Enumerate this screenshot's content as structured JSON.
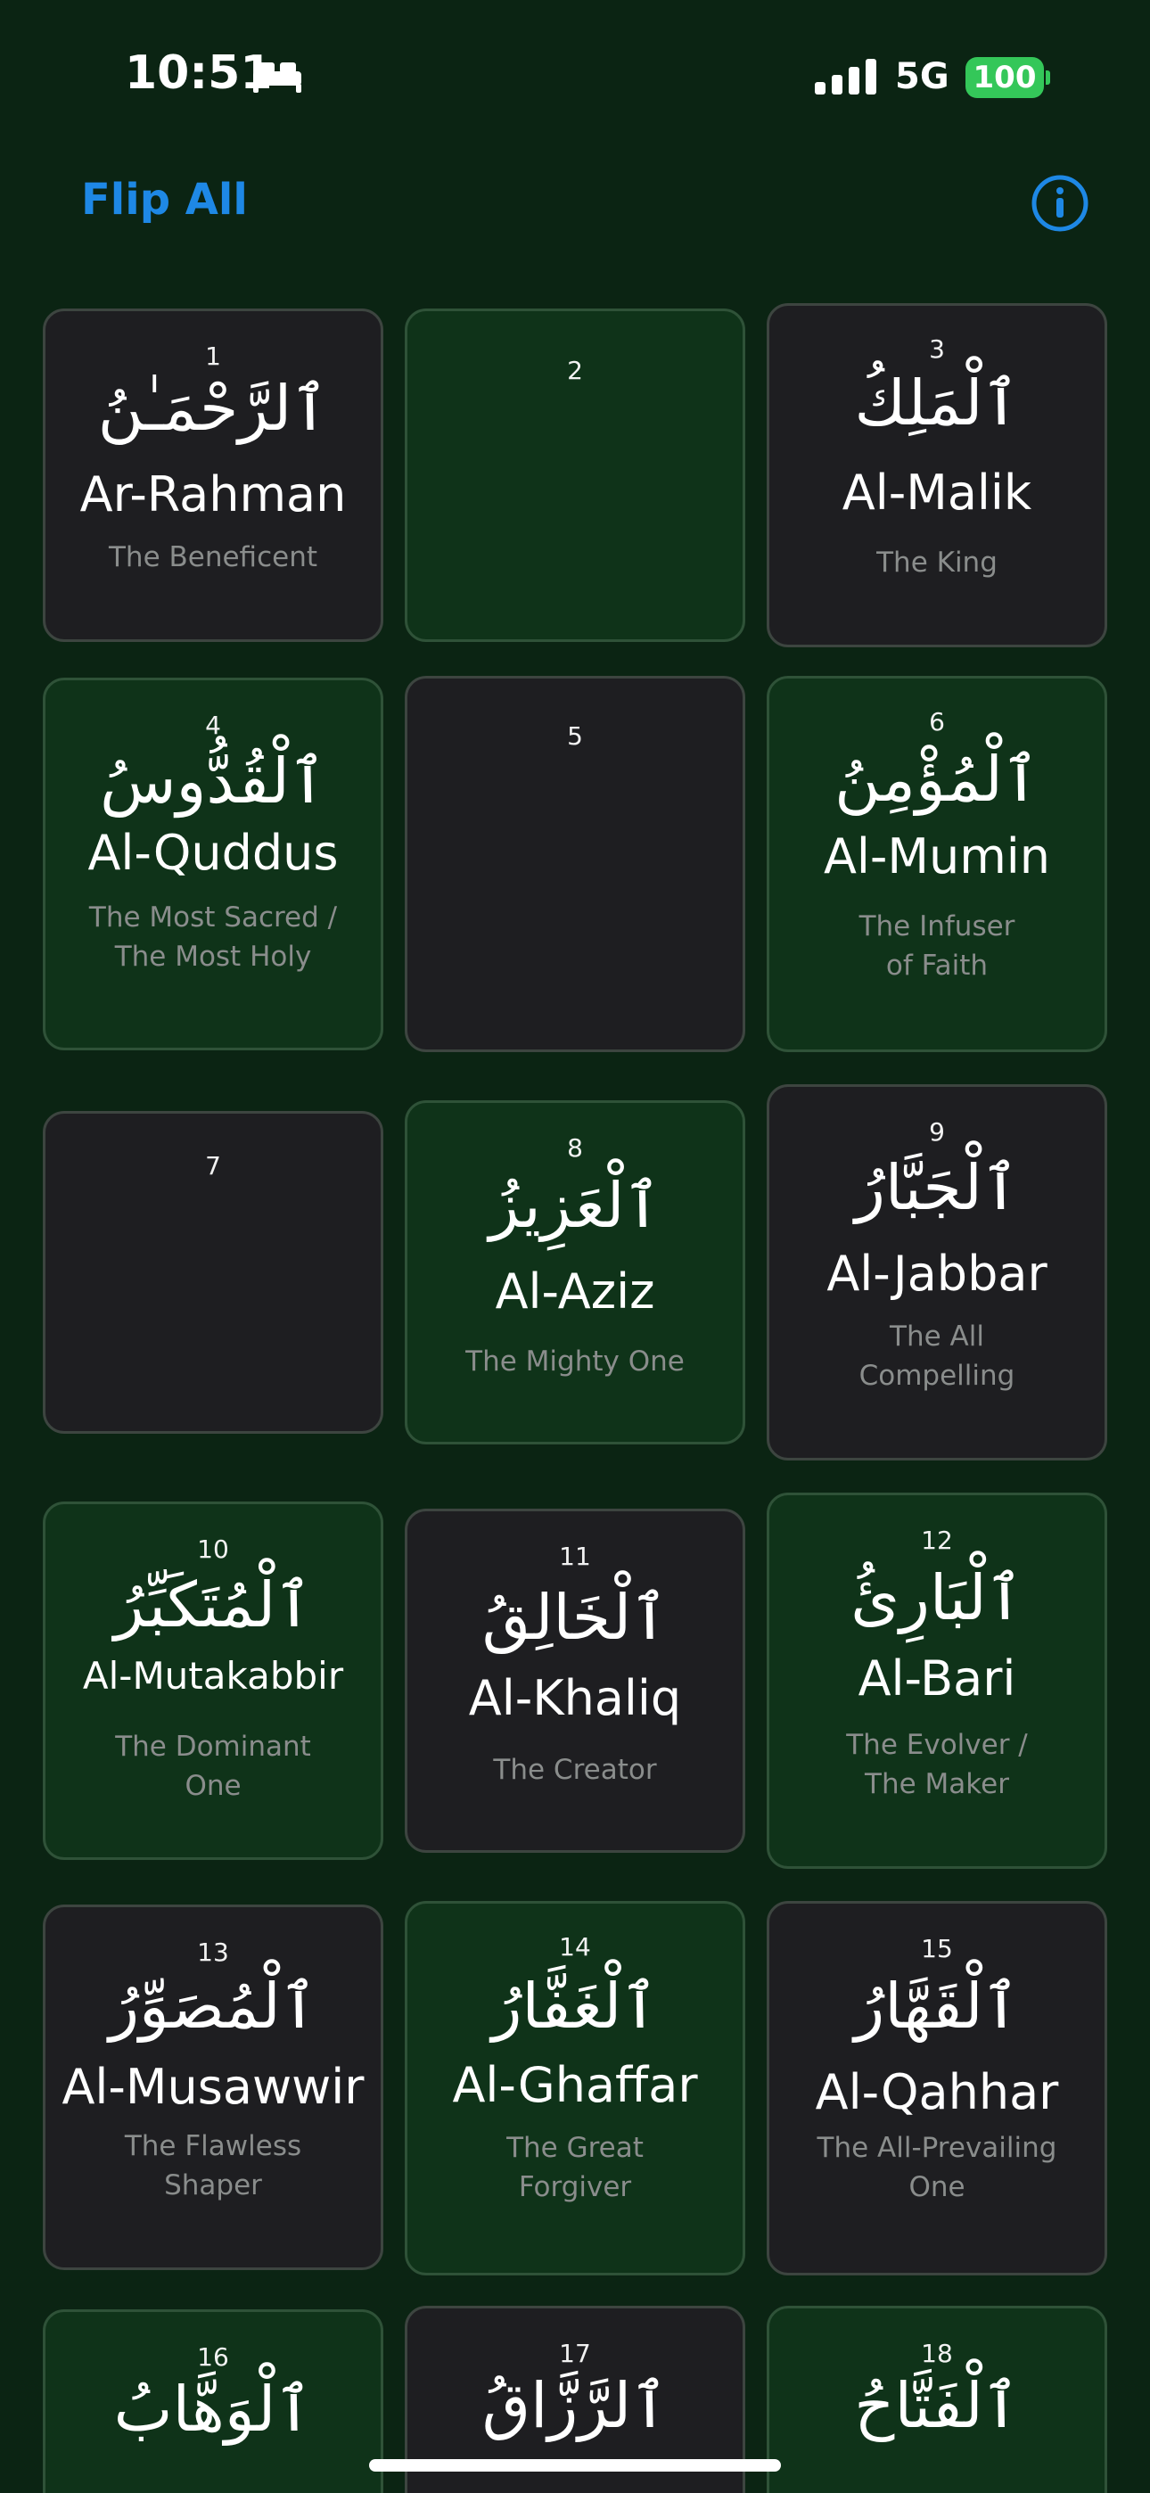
{
  "status_bar": {
    "time": "10:51",
    "network": "5G",
    "battery": "100",
    "focus_icon": "bed-icon",
    "signal_icon": "cellular-signal-icon"
  },
  "nav": {
    "flip_all_label": "Flip All",
    "info_icon": "info-icon"
  },
  "colors": {
    "background": "#0b2413",
    "card_dark": "#1e1e21",
    "card_green": "#0f3319",
    "accent_blue": "#1e88e5",
    "battery_green": "#34c759",
    "meaning_gray": "#8a8d8c"
  },
  "cards": [
    {
      "number": "1",
      "arabic": "ٱلرَّحْمَـٰنُ",
      "translit": "Ar-Rahman",
      "meaning": "The Beneficent",
      "flipped": true
    },
    {
      "number": "2",
      "arabic": "",
      "translit": "",
      "meaning": "",
      "flipped": false
    },
    {
      "number": "3",
      "arabic": "ٱلْمَلِكُ",
      "translit": "Al-Malik",
      "meaning": "The King",
      "flipped": true
    },
    {
      "number": "4",
      "arabic": "ٱلْقُدُّوسُ",
      "translit": "Al-Quddus",
      "meaning": "The Most Sacred /\nThe Most Holy",
      "flipped": true
    },
    {
      "number": "5",
      "arabic": "",
      "translit": "",
      "meaning": "",
      "flipped": false
    },
    {
      "number": "6",
      "arabic": "ٱلْمُؤْمِنُ",
      "translit": "Al-Mumin",
      "meaning": "The Infuser\nof Faith",
      "flipped": true
    },
    {
      "number": "7",
      "arabic": "",
      "translit": "",
      "meaning": "",
      "flipped": false
    },
    {
      "number": "8",
      "arabic": "ٱلْعَزِيزُ",
      "translit": "Al-Aziz",
      "meaning": "The Mighty One",
      "flipped": true
    },
    {
      "number": "9",
      "arabic": "ٱلْجَبَّارُ",
      "translit": "Al-Jabbar",
      "meaning": "The All\nCompelling",
      "flipped": true
    },
    {
      "number": "10",
      "arabic": "ٱلْمُتَكَبِّرُ",
      "translit": "Al-Mutakabbir",
      "meaning": "The Dominant\nOne",
      "flipped": true
    },
    {
      "number": "11",
      "arabic": "ٱلْخَالِقُ",
      "translit": "Al-Khaliq",
      "meaning": "The Creator",
      "flipped": true
    },
    {
      "number": "12",
      "arabic": "ٱلْبَارِئُ",
      "translit": "Al-Bari",
      "meaning": "The Evolver /\nThe Maker",
      "flipped": true
    },
    {
      "number": "13",
      "arabic": "ٱلْمُصَوِّرُ",
      "translit": "Al-Musawwir",
      "meaning": "The Flawless\nShaper",
      "flipped": true
    },
    {
      "number": "14",
      "arabic": "ٱلْغَفَّارُ",
      "translit": "Al-Ghaffar",
      "meaning": "The Great\nForgiver",
      "flipped": true
    },
    {
      "number": "15",
      "arabic": "ٱلْقَهَّارُ",
      "translit": "Al-Qahhar",
      "meaning": "The All-Prevailing\nOne",
      "flipped": true
    },
    {
      "number": "16",
      "arabic": "ٱلْوَهَّابُ",
      "translit": "",
      "meaning": "",
      "flipped": true
    },
    {
      "number": "17",
      "arabic": "ٱلرَّزَّاقُ",
      "translit": "",
      "meaning": "",
      "flipped": true
    },
    {
      "number": "18",
      "arabic": "ٱلْفَتَّاحُ",
      "translit": "",
      "meaning": "",
      "flipped": true
    }
  ]
}
